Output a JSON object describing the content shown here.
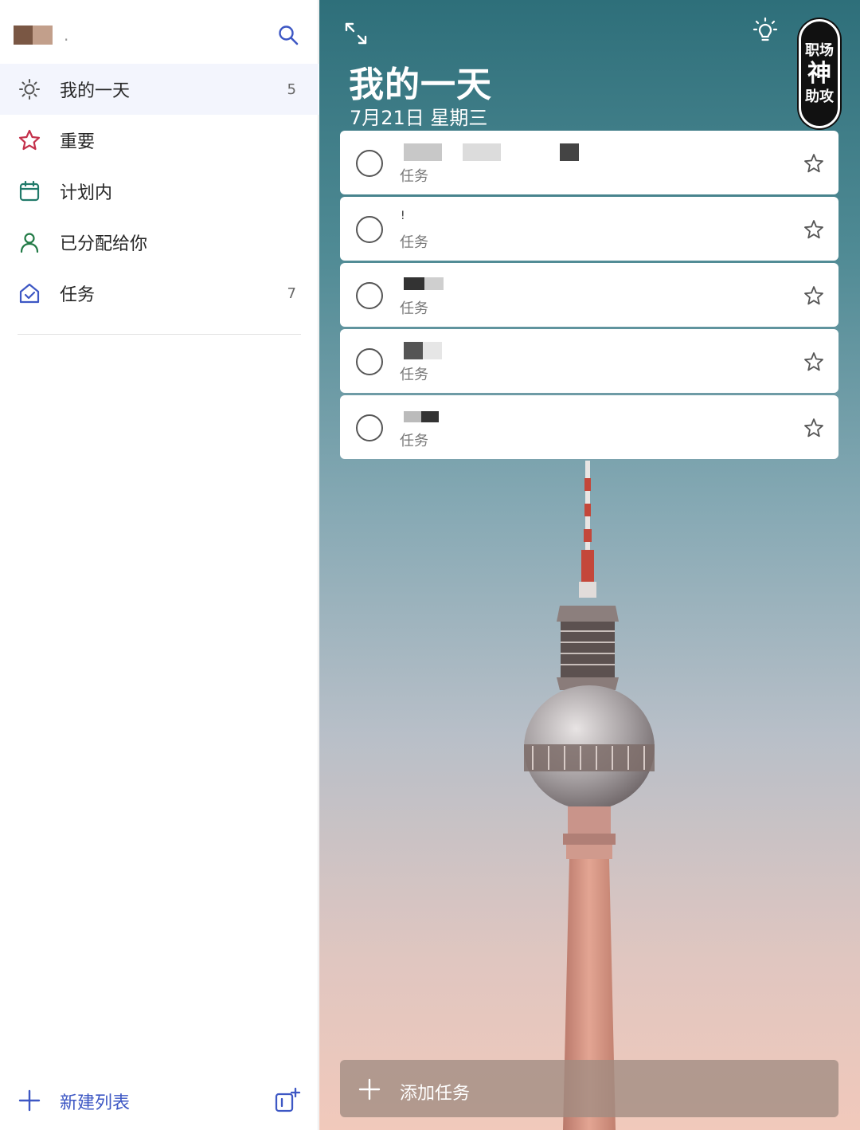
{
  "sidebar": {
    "account_name": ".",
    "nav": [
      {
        "label": "我的一天",
        "count": "5",
        "icon": "sun-icon",
        "active": true
      },
      {
        "label": "重要",
        "count": "",
        "icon": "star-icon"
      },
      {
        "label": "计划内",
        "count": "",
        "icon": "calendar-icon"
      },
      {
        "label": "已分配给你",
        "count": "",
        "icon": "person-icon"
      },
      {
        "label": "任务",
        "count": "7",
        "icon": "home-icon"
      }
    ],
    "new_list_label": "新建列表"
  },
  "main": {
    "title": "我的一天",
    "date": "7月21日 星期三",
    "stamp": {
      "line1": "职场",
      "line2": "神",
      "line3": "助攻"
    },
    "tasks": [
      {
        "title": "",
        "list": "任务"
      },
      {
        "title": "!",
        "list": "任务"
      },
      {
        "title": "",
        "list": "任务"
      },
      {
        "title": "",
        "list": "任务"
      },
      {
        "title": "",
        "list": "任务"
      }
    ],
    "add_task_label": "添加任务"
  },
  "colors": {
    "accent": "#3d57c4",
    "important": "#c4314b",
    "planned": "#217a6a",
    "assigned": "#217a45"
  }
}
